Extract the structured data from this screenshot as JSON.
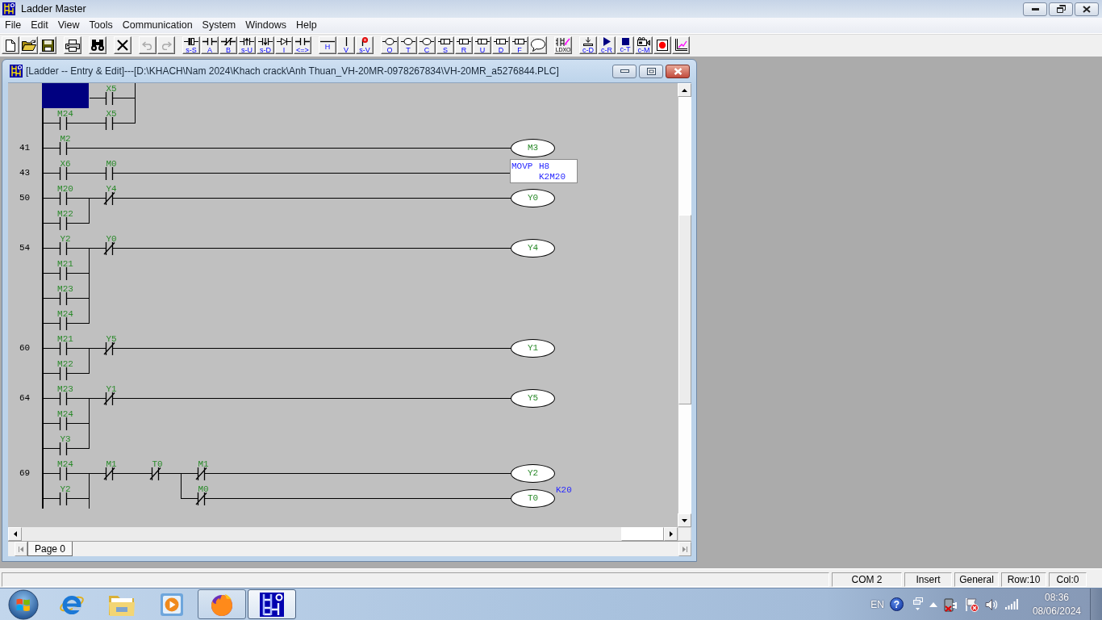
{
  "app": {
    "title": "Ladder Master"
  },
  "menu": [
    "File",
    "Edit",
    "View",
    "Tools",
    "Communication",
    "System",
    "Windows",
    "Help"
  ],
  "toolbar": [
    {
      "tools": [
        {
          "kind": "page",
          "disabled": false
        },
        {
          "kind": "folder",
          "disabled": false
        },
        {
          "kind": "disk",
          "disabled": false
        }
      ]
    },
    {
      "tools": [
        {
          "kind": "printer",
          "disabled": false
        }
      ]
    },
    {
      "tools": [
        {
          "kind": "binoculars",
          "disabled": false
        }
      ]
    },
    {
      "tools": [
        {
          "kind": "cross",
          "disabled": false
        }
      ]
    },
    {
      "tools": [
        {
          "kind": "undo",
          "disabled": true
        },
        {
          "kind": "redo",
          "disabled": true
        }
      ]
    },
    {
      "tools": [
        {
          "kind": "solid",
          "label": "s-S",
          "disabled": false
        },
        {
          "kind": "open",
          "label": "A",
          "disabled": false
        },
        {
          "kind": "closed",
          "label": "B",
          "disabled": false
        },
        {
          "kind": "rising",
          "label": "s-U",
          "disabled": false
        },
        {
          "kind": "falling",
          "label": "s-D",
          "disabled": false
        },
        {
          "kind": "invert",
          "label": "I",
          "disabled": false
        },
        {
          "kind": "compare",
          "label": "<=>",
          "disabled": false
        }
      ]
    },
    {
      "tools": [
        {
          "kind": "hline",
          "label": "H",
          "disabled": false
        },
        {
          "kind": "vline",
          "label": "V",
          "disabled": false
        },
        {
          "kind": "unlink",
          "label": "s-V",
          "disabled": false
        }
      ]
    },
    {
      "tools": [
        {
          "kind": "coil",
          "label": "O",
          "disabled": false
        },
        {
          "kind": "coil",
          "label": "T",
          "disabled": false
        },
        {
          "kind": "coil",
          "label": "C",
          "disabled": false
        },
        {
          "kind": "box",
          "label": "S",
          "disabled": false
        },
        {
          "kind": "box",
          "label": "R",
          "disabled": false
        },
        {
          "kind": "box",
          "label": "U",
          "disabled": false
        },
        {
          "kind": "box",
          "label": "D",
          "disabled": false
        },
        {
          "kind": "box",
          "label": "F",
          "disabled": false
        },
        {
          "kind": "bubble",
          "disabled": false
        }
      ]
    },
    {
      "tools": [
        {
          "kind": "convert",
          "label": "LDXO",
          "disabled": false
        }
      ]
    },
    {
      "tools": [
        {
          "kind": "download",
          "label": "c-D",
          "disabled": false
        },
        {
          "kind": "run",
          "label": "c-R",
          "disabled": false
        },
        {
          "kind": "stop",
          "label": "c-T",
          "disabled": false
        },
        {
          "kind": "monitor",
          "label": "c-M",
          "disabled": false
        },
        {
          "kind": "record",
          "disabled": false
        },
        {
          "kind": "chart",
          "disabled": false
        }
      ]
    }
  ],
  "editor": {
    "title": "[Ladder -- Entry & Edit]---[D:\\KHACH\\Nam 2024\\Khach crack\\Anh Thuan_VH-20MR-0978267834\\VH-20MR_a5276844.PLC]",
    "rows": [
      {
        "elements": [
          {
            "kind": "cursor",
            "up": false,
            "down": false
          },
          {
            "kind": "no",
            "label": "X5",
            "up": true,
            "down": true
          }
        ]
      },
      {
        "elements": [
          {
            "kind": "no",
            "label": "M24",
            "up": false,
            "down": false
          },
          {
            "kind": "no",
            "label": "X5",
            "up": true,
            "down": false
          }
        ]
      },
      {
        "step": "41",
        "elements": [
          {
            "kind": "no",
            "label": "M2",
            "up": false,
            "down": false
          }
        ],
        "output": {
          "kind": "coil",
          "label": "M3"
        }
      },
      {
        "step": "43",
        "elements": [
          {
            "kind": "no",
            "label": "X6",
            "up": false,
            "down": false
          },
          {
            "kind": "no",
            "label": "M0",
            "up": false,
            "down": false
          }
        ],
        "output": {
          "kind": "box",
          "instruction": "MOVP",
          "operands": [
            "H8",
            "K2M20"
          ]
        }
      },
      {
        "step": "50",
        "elements": [
          {
            "kind": "no",
            "label": "M20",
            "up": false,
            "down": true
          },
          {
            "kind": "nc",
            "label": "Y4",
            "up": false,
            "down": false
          }
        ],
        "output": {
          "kind": "coil",
          "label": "Y0"
        }
      },
      {
        "elements": [
          {
            "kind": "no",
            "label": "M22",
            "up": true,
            "down": false
          }
        ]
      },
      {
        "step": "54",
        "elements": [
          {
            "kind": "no",
            "label": "Y2",
            "up": false,
            "down": true
          },
          {
            "kind": "nc",
            "label": "Y0",
            "up": false,
            "down": false
          }
        ],
        "output": {
          "kind": "coil",
          "label": "Y4"
        }
      },
      {
        "elements": [
          {
            "kind": "no",
            "label": "M21",
            "up": true,
            "down": true
          }
        ]
      },
      {
        "elements": [
          {
            "kind": "no",
            "label": "M23",
            "up": true,
            "down": true
          }
        ]
      },
      {
        "elements": [
          {
            "kind": "no",
            "label": "M24",
            "up": true,
            "down": false
          }
        ]
      },
      {
        "step": "60",
        "elements": [
          {
            "kind": "no",
            "label": "M21",
            "up": false,
            "down": true
          },
          {
            "kind": "nc",
            "label": "Y5",
            "up": false,
            "down": false
          }
        ],
        "output": {
          "kind": "coil",
          "label": "Y1"
        }
      },
      {
        "elements": [
          {
            "kind": "no",
            "label": "M22",
            "up": true,
            "down": false
          }
        ]
      },
      {
        "step": "64",
        "elements": [
          {
            "kind": "no",
            "label": "M23",
            "up": false,
            "down": true
          },
          {
            "kind": "nc",
            "label": "Y1",
            "up": false,
            "down": false
          }
        ],
        "output": {
          "kind": "coil",
          "label": "Y5"
        }
      },
      {
        "elements": [
          {
            "kind": "no",
            "label": "M24",
            "up": true,
            "down": true
          }
        ]
      },
      {
        "elements": [
          {
            "kind": "no",
            "label": "Y3",
            "up": true,
            "down": false
          }
        ]
      },
      {
        "step": "69",
        "elements": [
          {
            "kind": "no",
            "label": "M24",
            "up": false,
            "down": true
          },
          {
            "kind": "nc",
            "label": "M1",
            "up": false,
            "down": false
          },
          {
            "kind": "nc",
            "label": "T0",
            "up": false,
            "down": true
          },
          {
            "kind": "nc",
            "label": "M1",
            "up": false,
            "down": false
          }
        ],
        "output": {
          "kind": "coil",
          "label": "Y2"
        }
      },
      {
        "elements": [
          {
            "kind": "no",
            "label": "Y2",
            "up": true,
            "down": true
          },
          {
            "kind": "empty"
          },
          {
            "kind": "empty",
            "up": true,
            "down": false
          },
          {
            "kind": "nc",
            "label": "M0",
            "up": false,
            "down": false
          }
        ],
        "output": {
          "kind": "coil",
          "label": "T0",
          "preset": "K20"
        }
      }
    ],
    "pages": [
      {
        "label": "Page 0",
        "selected": true
      }
    ]
  },
  "status_bar": {
    "panels": [
      "COM 2",
      "Insert",
      "General",
      "Row:10",
      "Col:0"
    ]
  },
  "taskbar": {
    "apps": [
      {
        "kind": "web",
        "running": false,
        "selected": false
      },
      {
        "kind": "folder",
        "running": false,
        "selected": false
      },
      {
        "kind": "media",
        "running": false,
        "selected": false
      },
      {
        "kind": "fox",
        "running": true,
        "selected": false
      },
      {
        "kind": "ladder",
        "running": true,
        "selected": true
      }
    ],
    "language": "EN",
    "help": "?",
    "time": "08:36",
    "date": "08/06/2024"
  }
}
